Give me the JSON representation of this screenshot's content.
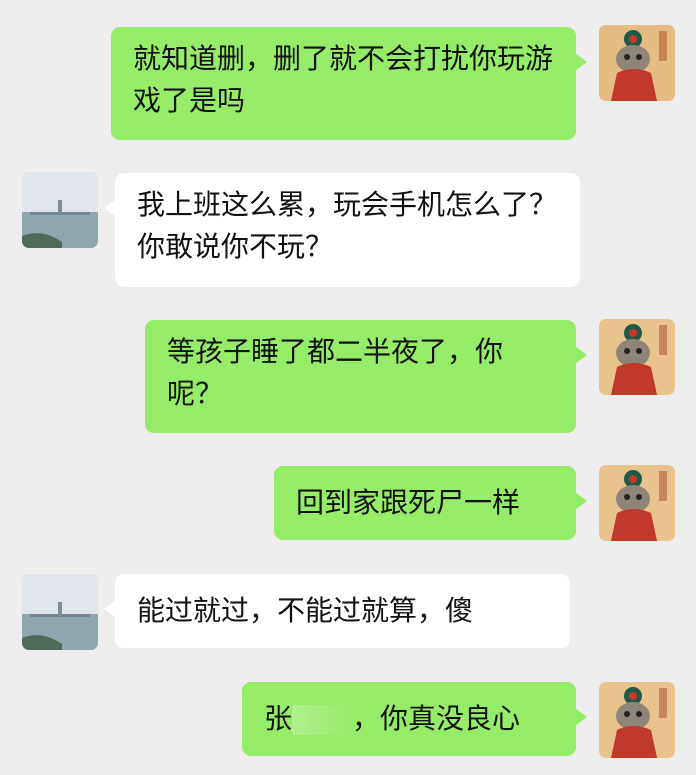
{
  "colors": {
    "me_bubble": "#95ec69",
    "other_bubble": "#ffffff",
    "background": "#ededed"
  },
  "messages": [
    {
      "sender": "me",
      "text": "就知道删，删了就不会打扰你玩游戏了是吗"
    },
    {
      "sender": "other",
      "text": "我上班这么累，玩会手机怎么了？你敢说你不玩？"
    },
    {
      "sender": "me",
      "text": "等孩子睡了都二半夜了，你呢？"
    },
    {
      "sender": "me",
      "text": "回到家跟死尸一样"
    },
    {
      "sender": "other",
      "text": "能过就过，不能过就算，傻"
    },
    {
      "sender": "me",
      "text_prefix": "张",
      "text_suffix": "，你真没良心"
    }
  ],
  "avatars": {
    "me": "cat-in-red-costume-avatar",
    "other": "lake-pagoda-avatar"
  }
}
